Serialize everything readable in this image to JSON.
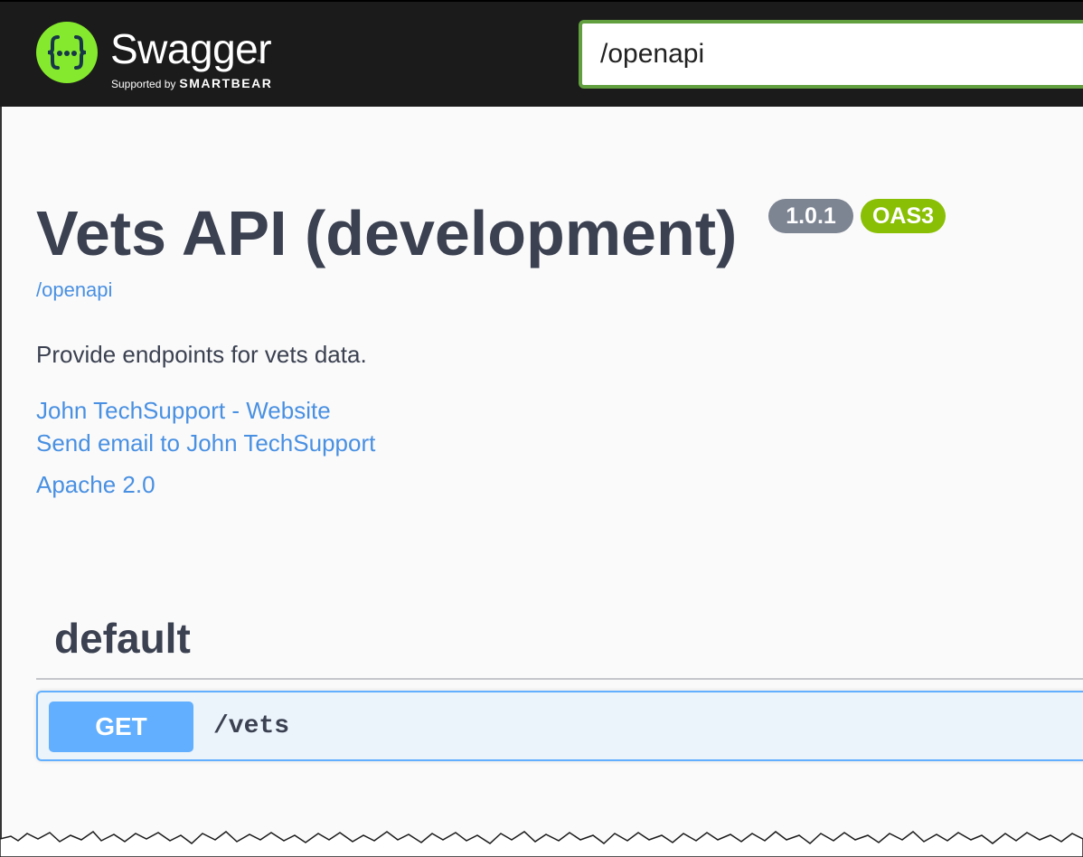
{
  "topbar": {
    "brand": "Swagger",
    "trademark": "™",
    "supported_by": "Supported by",
    "company": "SMARTBEAR",
    "url_value": "/openapi"
  },
  "info": {
    "title": "Vets API (development)",
    "version": "1.0.1",
    "oas_badge": "OAS3",
    "spec_url": "/openapi",
    "description": "Provide endpoints for vets data.",
    "contact_website": "John TechSupport - Website",
    "contact_email": "Send email to John TechSupport",
    "license": "Apache 2.0"
  },
  "tag": {
    "name": "default",
    "operations": [
      {
        "method": "GET",
        "path": "/vets"
      }
    ]
  },
  "colors": {
    "topbar_bg": "#1b1b1b",
    "logo_green": "#85ea2d",
    "input_border": "#62a03f",
    "title_text": "#3b4151",
    "link": "#4990e2",
    "version_badge": "#7d8492",
    "oas_badge": "#89bf04",
    "get_method": "#61affe",
    "get_block_bg": "#ebf3fb"
  },
  "icons": {
    "logo": "swagger-braces-icon"
  }
}
